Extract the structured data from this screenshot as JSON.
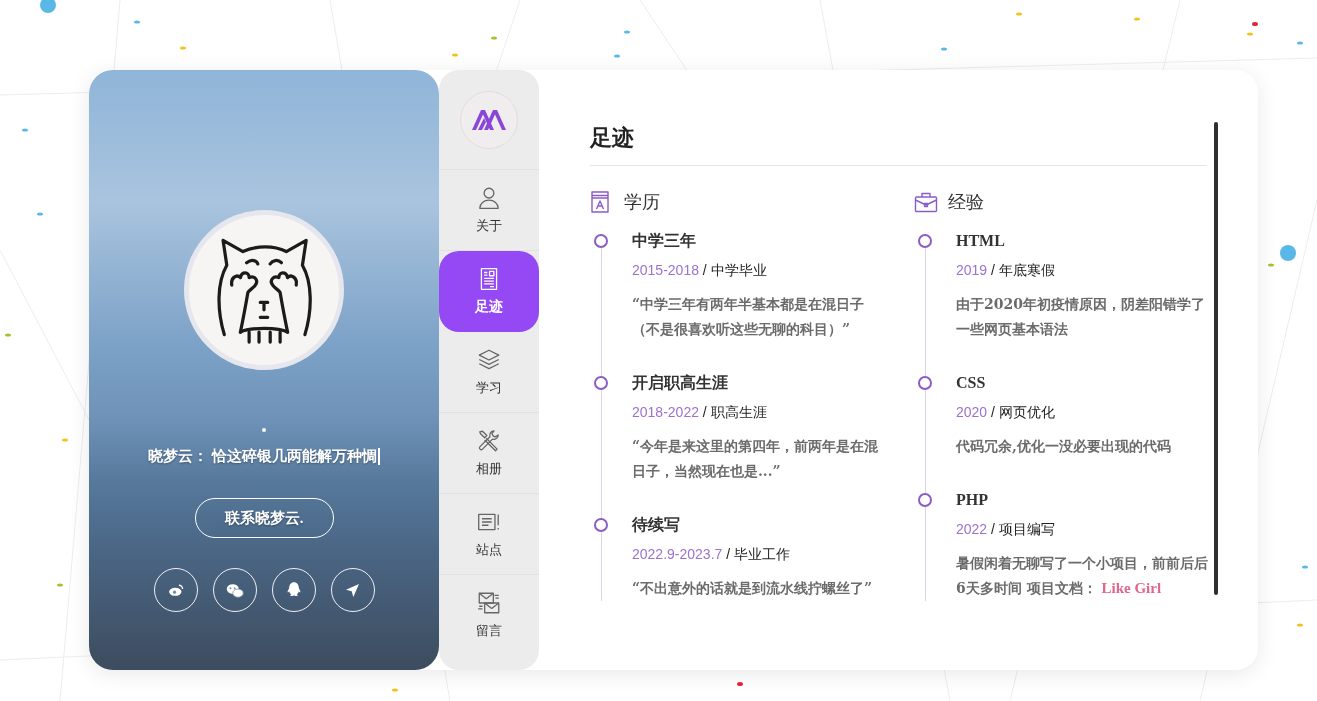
{
  "profile": {
    "motto": "晓梦云： 恰这碎银几两能解万种惆",
    "cursor": true,
    "contact_button": "联系晓梦云.",
    "social_links": [
      {
        "kind": "weibo"
      },
      {
        "kind": "wechat"
      },
      {
        "kind": "qq"
      },
      {
        "kind": "location"
      }
    ]
  },
  "nav": {
    "items": [
      {
        "label": "关于",
        "kind": "user",
        "selected": false
      },
      {
        "label": "足迹",
        "kind": "resume",
        "selected": true
      },
      {
        "label": "学习",
        "kind": "layers",
        "selected": false
      },
      {
        "label": "相册",
        "kind": "tools",
        "selected": false
      },
      {
        "label": "站点",
        "kind": "notes",
        "selected": false
      },
      {
        "label": "留言",
        "kind": "mail",
        "selected": false
      }
    ]
  },
  "content": {
    "title": "足迹",
    "sections": [
      {
        "heading": "学历",
        "kind": "education",
        "entries": [
          {
            "title": "中学三年",
            "period": "2015-2018",
            "separator": "/",
            "category": "中学毕业",
            "description": "“中学三年有两年半基本都是在混日子（不是很喜欢听这些无聊的科目）”"
          },
          {
            "title": "开启职高生涯",
            "period": "2018-2022",
            "separator": "/",
            "category": "职高生涯",
            "description": "“今年是来这里的第四年，前两年是在混日子，当然现在也是...”"
          },
          {
            "title": "待续写",
            "period": "2022.9-2023.7",
            "separator": "/",
            "category": "毕业工作",
            "description": "“不出意外的话就是到流水线拧螺丝了”"
          }
        ]
      },
      {
        "heading": "经验",
        "kind": "experience",
        "entries": [
          {
            "title": "HTML",
            "period": "2019",
            "separator": "/",
            "category": "年底寒假",
            "description": "由于2020年初疫情原因，阴差阳错学了一些网页基本语法"
          },
          {
            "title": "CSS",
            "period": "2020",
            "separator": "/",
            "category": "网页优化",
            "description": "代码冗余,优化一没必要出现的代码"
          },
          {
            "title": "PHP",
            "period": "2022",
            "separator": "/",
            "category": "项目编写",
            "description": "暑假闲着无聊写了一个小项目，前前后后6天多时间 项目文档：",
            "link": "Like Girl"
          }
        ]
      }
    ]
  }
}
